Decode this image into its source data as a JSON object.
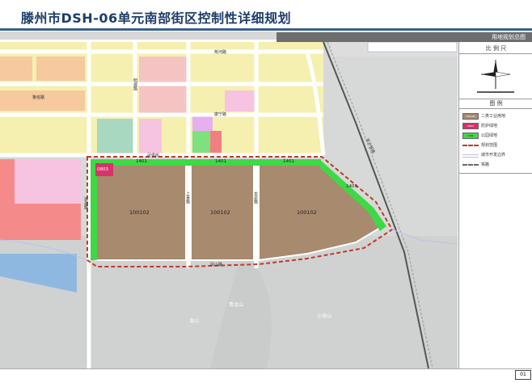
{
  "header": {
    "title": "滕州市DSH-06单元南部街区控制性详细规划",
    "plan_name": "用地规划总图"
  },
  "scale_section": {
    "title": "比 例 尺"
  },
  "legend": {
    "title": "图 例",
    "items": [
      {
        "code": "100102",
        "label": "二类工业用地",
        "color": "#a88a6e"
      },
      {
        "code": "0803",
        "label": "防护绿地",
        "color": "#d8326a"
      },
      {
        "code": "1401",
        "label": "公园绿地",
        "color": "#3fd846"
      },
      {
        "code": "",
        "label": "规划范围",
        "color": "#c0392b"
      },
      {
        "code": "",
        "label": "城市开发边界",
        "color": "#c0c0e8"
      },
      {
        "code": "",
        "label": "铁路",
        "color": "#666666"
      }
    ]
  },
  "map": {
    "parcels": [
      {
        "code": "100102",
        "name": "parcel-west"
      },
      {
        "code": "100102",
        "name": "parcel-middle"
      },
      {
        "code": "100102",
        "name": "parcel-east"
      }
    ],
    "green_code": "1401",
    "corner_code": "0803",
    "roads": {
      "north": "武侯街",
      "south": "凤山路",
      "west": "张泉路",
      "mid1": "上善路",
      "mid2": "龙泉路",
      "top": "荆河路",
      "upper_mid": "康宁路",
      "upper_left": "鲁班路",
      "upper_center": "明德路",
      "diagonal": "京沪铁路"
    },
    "places": [
      "青龙山",
      "龙山",
      "小龙山"
    ]
  },
  "footer": {
    "page_number": "01"
  }
}
